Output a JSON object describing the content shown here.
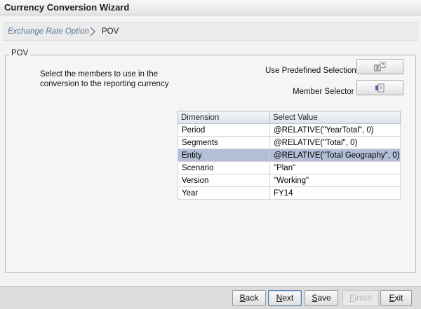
{
  "window": {
    "title": "Currency Conversion Wizard"
  },
  "breadcrumb": {
    "previous": "Exchange Rate Option",
    "current": "POV"
  },
  "pov": {
    "legend": "POV",
    "instructions": "Select the members to use in the conversion to the reporting currency",
    "predefined_label": "Use Predefined Selection",
    "member_selector_label": "Member Selector"
  },
  "grid": {
    "columns": [
      "Dimension",
      "Select Value"
    ],
    "rows": [
      {
        "dimension": "Period",
        "value": "@RELATIVE(\"YearTotal\", 0)"
      },
      {
        "dimension": "Segments",
        "value": "@RELATIVE(\"Total\", 0)"
      },
      {
        "dimension": "Entity",
        "value": "@RELATIVE(\"Total Geography\", 0)",
        "selected": true
      },
      {
        "dimension": "Scenario",
        "value": "\"Plan\""
      },
      {
        "dimension": "Version",
        "value": "\"Working\""
      },
      {
        "dimension": "Year",
        "value": "FY14"
      }
    ]
  },
  "buttons": {
    "back": {
      "u": "B",
      "rest": "ack"
    },
    "next": {
      "u": "N",
      "rest": "ext"
    },
    "save": {
      "u": "S",
      "rest": "ave"
    },
    "finish": {
      "u": "F",
      "rest": "inish",
      "enabled": false
    },
    "exit": {
      "u": "E",
      "rest": "xit"
    }
  },
  "icons": {
    "predefined_selection": "predefined-selection-icon",
    "member_selector": "member-selector-icon",
    "breadcrumb_separator": "chevron-right-icon"
  }
}
